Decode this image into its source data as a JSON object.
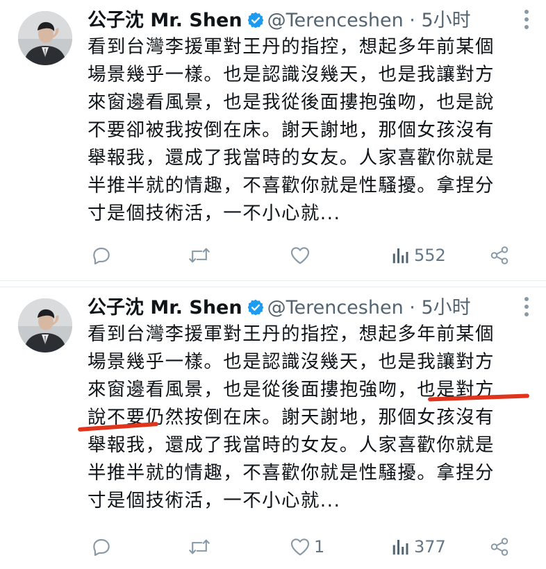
{
  "tweets": [
    {
      "display_name": "公子沈 Mr. Shen",
      "handle": "@Terenceshen",
      "separator": "·",
      "time": "5小时",
      "lines": [
        "看到台灣李援軍對王丹的指控，想起多年前某個",
        "場景幾乎一樣。也是認識沒幾天，也是我讓對方",
        "來窗邊看風景，也是我從後面摟抱強吻，也是說",
        "不要卻被我按倒在床。謝天謝地，那個女孩沒有",
        "舉報我，還成了我當時的女友。人家喜歡你就是",
        "半推半就的情趣，不喜歡你就是性騷擾。拿捏分",
        "寸是個技術活，一不小心就..."
      ],
      "reply_count": "",
      "retweet_count": "",
      "like_count": "",
      "views_count": "552"
    },
    {
      "display_name": "公子沈 Mr. Shen",
      "handle": "@Terenceshen",
      "separator": "·",
      "time": "5小时",
      "lines": [
        "看到台灣李援軍對王丹的指控，想起多年前某個",
        "場景幾乎一樣。也是認識沒幾天，也是我讓對方",
        "來窗邊看風景，也是從後面摟抱強吻，也是對方",
        "說不要仍然按倒在床。謝天謝地，那個女孩沒有",
        "舉報我，還成了我當時的女友。人家喜歡你就是",
        "半推半就的情趣，不喜歡你就是性騷擾。拿捏分",
        "寸是個技術活，一不小心就..."
      ],
      "reply_count": "",
      "retweet_count": "",
      "like_count": "1",
      "views_count": "377"
    }
  ],
  "icons": {
    "reply": "reply-icon",
    "retweet": "retweet-icon",
    "like": "heart-icon",
    "views": "views-icon",
    "share": "share-icon",
    "verified": "verified-badge-icon",
    "more": "more-icon"
  },
  "colors": {
    "text": "#0f1419",
    "secondary": "#536471",
    "icon": "#657786",
    "verified": "#1d9bf0",
    "annotation": "#e0341c"
  }
}
